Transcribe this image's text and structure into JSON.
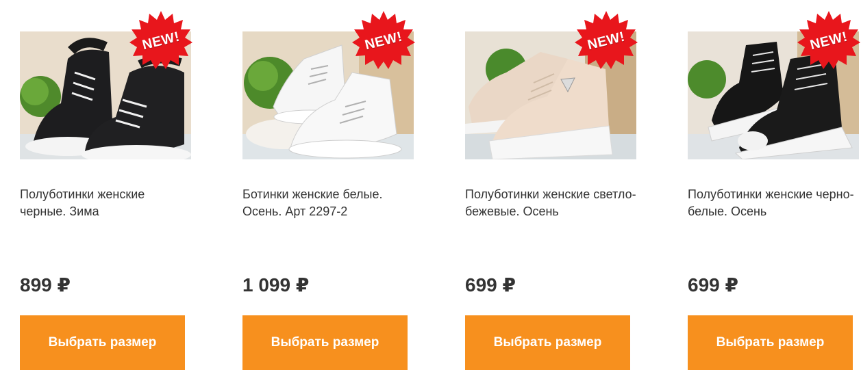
{
  "badge_label": "NEW!",
  "colors": {
    "button": "#f7901e",
    "badge": "#e8161c",
    "text": "#333333"
  },
  "products": [
    {
      "title": "Полуботинки женские черные. Зима",
      "price": "899 ₽",
      "button_label": "Выбрать размер",
      "image": "black-winter-sneaker-boots-photo"
    },
    {
      "title": "Ботинки женские белые. Осень. Арт 2297-2",
      "price": "1 099 ₽",
      "button_label": "Выбрать размер",
      "image": "white-high-top-sneakers-photo"
    },
    {
      "title": "Полуботинки женские светло-бежевые. Осень",
      "price": "699 ₽",
      "button_label": "Выбрать размер",
      "image": "beige-chunky-sneakers-photo"
    },
    {
      "title": "Полуботинки женские черно-белые. Осень",
      "price": "699 ₽",
      "button_label": "Выбрать размер",
      "image": "black-white-platform-sneakers-photo"
    }
  ]
}
